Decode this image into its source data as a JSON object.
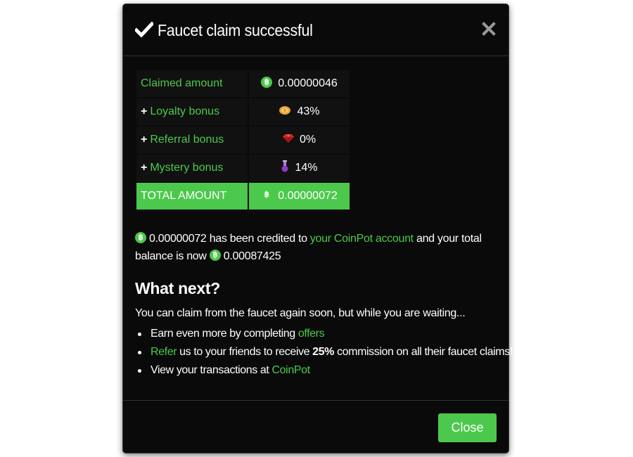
{
  "modal": {
    "title": "Faucet claim successful",
    "close_icon": "close-x-icon",
    "check_icon": "checkmark-icon"
  },
  "claim_table": {
    "rows": [
      {
        "prefix": "",
        "label": "Claimed amount",
        "icon": "bitcoin-icon",
        "value": "0.00000046"
      },
      {
        "prefix": "+",
        "label": "Loyalty bonus",
        "icon": "loyalty-coin-icon",
        "value": "43%"
      },
      {
        "prefix": "+",
        "label": "Referral bonus",
        "icon": "ruby-gem-icon",
        "value": "0%"
      },
      {
        "prefix": "+",
        "label": "Mystery bonus",
        "icon": "mystery-potion-icon",
        "value": "14%"
      }
    ],
    "total": {
      "label": "TOTAL AMOUNT",
      "icon": "bitcoin-icon",
      "value": "0.00000072"
    },
    "btc_symbol": "฿"
  },
  "credit": {
    "amount": "0.00000072",
    "text_before_link": " has been credited to ",
    "link": "your CoinPot account",
    "text_after_link": " and your total balance is now ",
    "balance": "0.00087425"
  },
  "what_next": {
    "heading": "What next?",
    "intro": "You can claim from the faucet again soon, but while you are waiting...",
    "tips": {
      "offers_prefix": "Earn even more by completing ",
      "offers_link": "offers",
      "refer_link": "Refer",
      "refer_middle": " us to your friends to receive ",
      "refer_bold": "25%",
      "refer_suffix": " commission on all their faucet claims!",
      "coinpot_prefix": "View your transactions at ",
      "coinpot_link": "CoinPot"
    }
  },
  "footer": {
    "close_label": "Close"
  },
  "colors": {
    "accent": "#4cc94c",
    "modal_bg": "#0a0a0a",
    "cell_bg": "#111111",
    "backdrop": "#ffffff"
  }
}
